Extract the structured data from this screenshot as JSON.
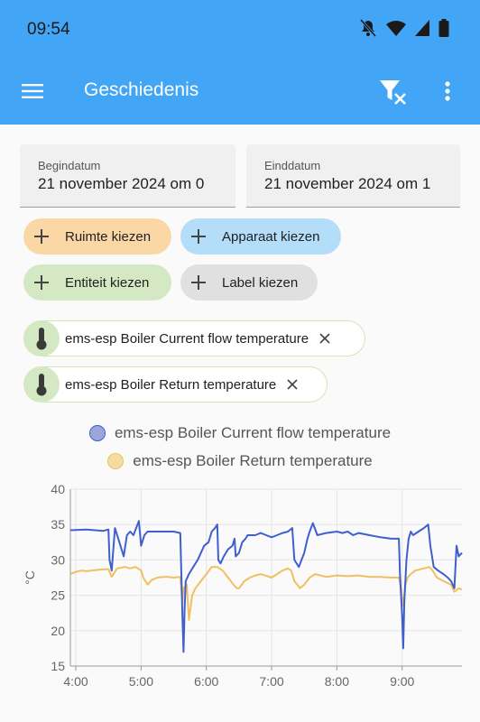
{
  "status": {
    "time": "09:54"
  },
  "appbar": {
    "title": "Geschiedenis"
  },
  "dates": {
    "start_label": "Begindatum",
    "start_value": "21 november 2024 om 0",
    "end_label": "Einddatum",
    "end_value": "21 november 2024 om 1"
  },
  "chips": {
    "area": "Ruimte kiezen",
    "device": "Apparaat kiezen",
    "entity": "Entiteit kiezen",
    "label": "Label kiezen"
  },
  "selected": [
    {
      "label": "ems-esp Boiler Current flow temperature"
    },
    {
      "label": "ems-esp Boiler Return temperature"
    }
  ],
  "colors": {
    "accent": "#42a5f5",
    "area_chip": "#fbd7a6",
    "device_chip": "#b3ddf8",
    "entity_chip": "#d4e9c3",
    "label_chip": "#e0e0e0",
    "flow_series": "#3f5fcf",
    "return_series": "#f0c060"
  },
  "chart_data": {
    "type": "line",
    "ylabel": "°C",
    "ylim": [
      15,
      40
    ],
    "yticks": [
      15,
      20,
      25,
      30,
      35,
      40
    ],
    "xlim": [
      "03:55",
      "09:55"
    ],
    "xticks": [
      "4:00",
      "5:00",
      "6:00",
      "7:00",
      "8:00",
      "9:00"
    ],
    "grid": true,
    "legend": "top",
    "series": [
      {
        "name": "ems-esp Boiler Current flow temperature",
        "points": [
          [
            "03:55",
            34.2
          ],
          [
            "04:10",
            34.3
          ],
          [
            "04:25",
            34.1
          ],
          [
            "04:30",
            34.3
          ],
          [
            "04:31",
            30.0
          ],
          [
            "04:33",
            28.5
          ],
          [
            "04:36",
            34.5
          ],
          [
            "04:40",
            32.5
          ],
          [
            "04:44",
            30.5
          ],
          [
            "04:47",
            33.5
          ],
          [
            "04:50",
            34.0
          ],
          [
            "04:53",
            33.5
          ],
          [
            "04:58",
            35.5
          ],
          [
            "05:00",
            32.0
          ],
          [
            "05:03",
            33.5
          ],
          [
            "05:06",
            34.0
          ],
          [
            "05:15",
            34.0
          ],
          [
            "05:30",
            34.0
          ],
          [
            "05:36",
            33.8
          ],
          [
            "05:37",
            28.0
          ],
          [
            "05:38",
            22.0
          ],
          [
            "05:39",
            17.0
          ],
          [
            "05:40",
            23.0
          ],
          [
            "05:41",
            27.0
          ],
          [
            "05:44",
            28.0
          ],
          [
            "05:48",
            29.0
          ],
          [
            "05:52",
            30.0
          ],
          [
            "05:55",
            31.0
          ],
          [
            "05:58",
            32.0
          ],
          [
            "06:02",
            32.5
          ],
          [
            "06:05",
            34.0
          ],
          [
            "06:08",
            34.5
          ],
          [
            "06:10",
            35.0
          ],
          [
            "06:11",
            30.0
          ],
          [
            "06:13",
            29.5
          ],
          [
            "06:16",
            30.5
          ],
          [
            "06:20",
            31.5
          ],
          [
            "06:24",
            32.0
          ],
          [
            "06:26",
            33.0
          ],
          [
            "06:27",
            30.5
          ],
          [
            "06:30",
            31.0
          ],
          [
            "06:33",
            32.5
          ],
          [
            "06:36",
            33.0
          ],
          [
            "06:38",
            33.5
          ],
          [
            "06:40",
            33.5
          ],
          [
            "06:45",
            33.5
          ],
          [
            "06:50",
            33.8
          ],
          [
            "06:55",
            33.5
          ],
          [
            "07:00",
            33.2
          ],
          [
            "07:05",
            33.5
          ],
          [
            "07:10",
            33.8
          ],
          [
            "07:15",
            34.0
          ],
          [
            "07:19",
            34.5
          ],
          [
            "07:21",
            30.0
          ],
          [
            "07:25",
            29.0
          ],
          [
            "07:30",
            31.0
          ],
          [
            "07:33",
            33.0
          ],
          [
            "07:35",
            34.0
          ],
          [
            "07:38",
            35.2
          ],
          [
            "07:42",
            33.5
          ],
          [
            "07:50",
            33.8
          ],
          [
            "08:00",
            34.0
          ],
          [
            "08:05",
            33.8
          ],
          [
            "08:10",
            34.0
          ],
          [
            "08:15",
            33.5
          ],
          [
            "08:20",
            33.8
          ],
          [
            "08:30",
            33.5
          ],
          [
            "08:40",
            33.2
          ],
          [
            "08:50",
            33.0
          ],
          [
            "08:55",
            33.0
          ],
          [
            "08:57",
            33.0
          ],
          [
            "08:58",
            28.0
          ],
          [
            "09:00",
            22.0
          ],
          [
            "09:01",
            17.5
          ],
          [
            "09:02",
            24.0
          ],
          [
            "09:04",
            30.0
          ],
          [
            "09:06",
            33.0
          ],
          [
            "09:08",
            34.0
          ],
          [
            "09:10",
            33.5
          ],
          [
            "09:15",
            34.0
          ],
          [
            "09:20",
            34.5
          ],
          [
            "09:24",
            35.0
          ],
          [
            "09:26",
            32.0
          ],
          [
            "09:29",
            29.0
          ],
          [
            "09:33",
            28.5
          ],
          [
            "09:38",
            28.0
          ],
          [
            "09:42",
            27.5
          ],
          [
            "09:45",
            27.0
          ],
          [
            "09:48",
            26.0
          ],
          [
            "09:50",
            32.0
          ],
          [
            "09:52",
            30.5
          ],
          [
            "09:55",
            31.0
          ]
        ]
      },
      {
        "name": "ems-esp Boiler Return temperature",
        "points": [
          [
            "03:55",
            28.0
          ],
          [
            "04:00",
            28.3
          ],
          [
            "04:05",
            28.5
          ],
          [
            "04:10",
            28.4
          ],
          [
            "04:20",
            28.6
          ],
          [
            "04:30",
            28.7
          ],
          [
            "04:33",
            27.6
          ],
          [
            "04:38",
            28.8
          ],
          [
            "04:45",
            29.0
          ],
          [
            "04:50",
            28.8
          ],
          [
            "04:55",
            29.0
          ],
          [
            "05:00",
            28.5
          ],
          [
            "05:02",
            27.5
          ],
          [
            "05:06",
            26.5
          ],
          [
            "05:10",
            27.2
          ],
          [
            "05:15",
            27.5
          ],
          [
            "05:20",
            27.6
          ],
          [
            "05:25",
            27.6
          ],
          [
            "05:30",
            27.5
          ],
          [
            "05:36",
            27.6
          ],
          [
            "05:38",
            24.0
          ],
          [
            "05:39",
            26.0
          ],
          [
            "05:42",
            26.5
          ],
          [
            "05:44",
            21.5
          ],
          [
            "05:47",
            25.0
          ],
          [
            "05:50",
            26.0
          ],
          [
            "05:55",
            27.0
          ],
          [
            "06:00",
            28.0
          ],
          [
            "06:05",
            29.0
          ],
          [
            "06:10",
            29.0
          ],
          [
            "06:15",
            28.5
          ],
          [
            "06:20",
            27.5
          ],
          [
            "06:25",
            26.5
          ],
          [
            "06:28",
            26.0
          ],
          [
            "06:30",
            26.0
          ],
          [
            "06:35",
            27.0
          ],
          [
            "06:40",
            27.5
          ],
          [
            "06:45",
            27.8
          ],
          [
            "06:50",
            28.0
          ],
          [
            "07:00",
            27.5
          ],
          [
            "07:05",
            28.0
          ],
          [
            "07:10",
            28.5
          ],
          [
            "07:15",
            28.8
          ],
          [
            "07:18",
            28.5
          ],
          [
            "07:21",
            27.0
          ],
          [
            "07:26",
            26.0
          ],
          [
            "07:30",
            26.5
          ],
          [
            "07:35",
            27.5
          ],
          [
            "07:40",
            28.0
          ],
          [
            "07:45",
            27.8
          ],
          [
            "07:50",
            27.6
          ],
          [
            "08:00",
            27.8
          ],
          [
            "08:10",
            27.7
          ],
          [
            "08:20",
            27.8
          ],
          [
            "08:30",
            27.6
          ],
          [
            "08:40",
            27.6
          ],
          [
            "08:50",
            27.5
          ],
          [
            "08:57",
            27.5
          ],
          [
            "08:59",
            26.0
          ],
          [
            "09:01",
            23.5
          ],
          [
            "09:03",
            26.5
          ],
          [
            "09:05",
            27.5
          ],
          [
            "09:08",
            28.0
          ],
          [
            "09:12",
            28.5
          ],
          [
            "09:20",
            28.8
          ],
          [
            "09:25",
            29.0
          ],
          [
            "09:28",
            28.5
          ],
          [
            "09:32",
            27.5
          ],
          [
            "09:38",
            27.0
          ],
          [
            "09:45",
            26.5
          ],
          [
            "09:48",
            25.5
          ],
          [
            "09:52",
            26.0
          ],
          [
            "09:55",
            25.8
          ]
        ]
      }
    ]
  }
}
